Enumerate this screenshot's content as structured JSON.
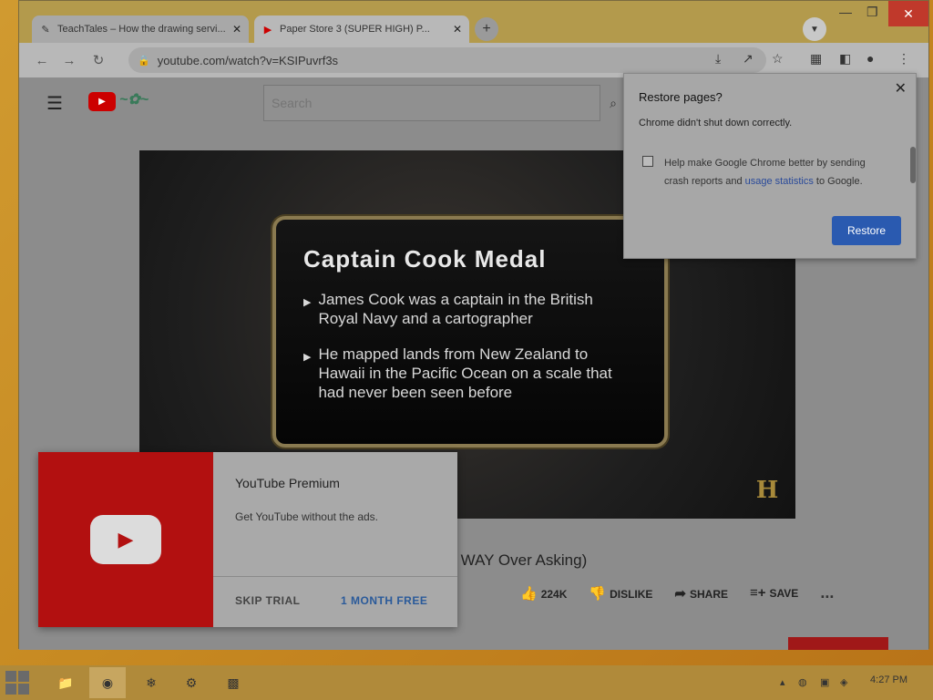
{
  "browser": {
    "tabs": [
      {
        "label": "TeachTales – How the drawing servi...",
        "favicon": "pen-icon"
      },
      {
        "label": "Paper Store 3 (SUPER HIGH) P...",
        "favicon": "youtube-icon"
      }
    ],
    "address": "youtube.com/watch?v=KSIPuvrf3s"
  },
  "youtube": {
    "search_placeholder": "Search",
    "video": {
      "card_title": "Captain Cook Medal",
      "bullets": [
        "James Cook was a captain in the British Royal Navy and a cartographer",
        "He mapped lands from New Zealand to Hawaii in the Pacific Ocean on a scale that had never been seen before"
      ],
      "channel_logo": "H"
    },
    "title_fragment": "ce WAY Over Asking)",
    "actions": {
      "likes": "224K",
      "dislike": "DISLIKE",
      "share": "SHARE",
      "save": "SAVE",
      "more": "..."
    }
  },
  "premium_popup": {
    "title": "YouTube Premium",
    "subtitle": "Get YouTube without the ads.",
    "skip": "SKIP TRIAL",
    "cta": "1 MONTH FREE"
  },
  "restore_popup": {
    "title": "Restore pages?",
    "message": "Chrome didn't shut down correctly.",
    "help_text_pre": "Help make Google Chrome better by sending crash reports and ",
    "help_link": "usage statistics",
    "help_text_post": " to Google.",
    "button": "Restore"
  },
  "taskbar": {
    "clock": "4:27 PM"
  },
  "colors": {
    "accent_blue": "#2a5ab0",
    "youtube_red": "#b21010",
    "close_red": "#c0392b"
  }
}
